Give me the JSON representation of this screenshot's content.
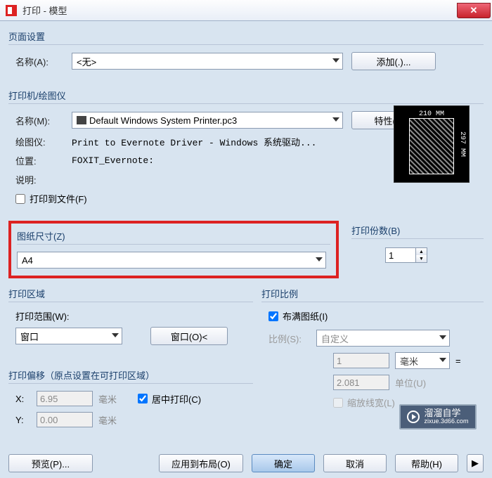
{
  "titlebar": {
    "title": "打印 - 模型"
  },
  "page_setup": {
    "heading": "页面设置",
    "name_label": "名称(A):",
    "name_value": "<无>",
    "add_btn": "添加(.)..."
  },
  "printer": {
    "heading": "打印机/绘图仪",
    "name_label": "名称(M):",
    "name_value": "Default Windows System Printer.pc3",
    "props_btn": "特性(R)...",
    "plotter_label": "绘图仪:",
    "plotter_value": "Print to Evernote Driver - Windows 系统驱动...",
    "location_label": "位置:",
    "location_value": "FOXIT_Evernote:",
    "desc_label": "说明:",
    "print_to_file": "打印到文件(F)",
    "preview_w": "210 MM",
    "preview_h": "297 MM"
  },
  "paper_size": {
    "heading": "图纸尺寸(Z)",
    "value": "A4"
  },
  "copies": {
    "heading": "打印份数(B)",
    "value": "1"
  },
  "area": {
    "heading": "打印区域",
    "range_label": "打印范围(W):",
    "range_value": "窗口",
    "window_btn": "窗口(O)<"
  },
  "scale": {
    "heading": "打印比例",
    "fit_label": "布满图纸(I)",
    "scale_label": "比例(S):",
    "scale_value": "自定义",
    "num": "1",
    "unit": "毫米",
    "eq": "=",
    "denom": "2.081",
    "denom_unit": "单位(U)",
    "lineweight": "缩放线宽(L)"
  },
  "offset": {
    "heading": "打印偏移（原点设置在可打印区域）",
    "x_label": "X:",
    "x_value": "6.95",
    "x_unit": "毫米",
    "y_label": "Y:",
    "y_value": "0.00",
    "y_unit": "毫米",
    "center": "居中打印(C)"
  },
  "buttons": {
    "preview": "预览(P)...",
    "apply": "应用到布局(O)",
    "ok": "确定",
    "cancel": "取消",
    "help": "帮助(H)"
  },
  "watermark": {
    "line1": "溜溜自学",
    "line2": "zixue.3d66.com"
  }
}
